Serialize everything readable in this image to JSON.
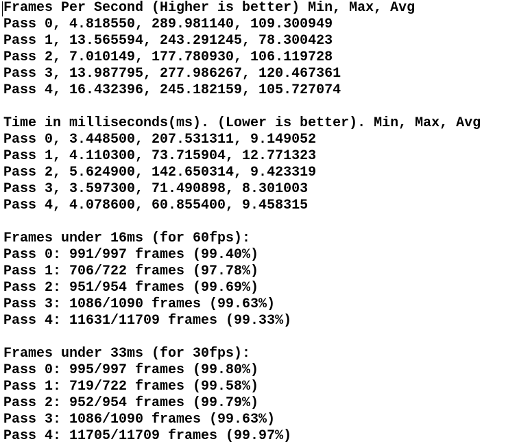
{
  "sections": [
    {
      "header": "Frames Per Second (Higher is better) Min, Max, Avg",
      "lines": [
        "Pass 0, 4.818550, 289.981140, 109.300949",
        "Pass 1, 13.565594, 243.291245, 78.300423",
        "Pass 2, 7.010149, 177.780930, 106.119728",
        "Pass 3, 13.987795, 277.986267, 120.467361",
        "Pass 4, 16.432396, 245.182159, 105.727074"
      ]
    },
    {
      "header": "Time in milliseconds(ms). (Lower is better). Min, Max, Avg",
      "lines": [
        "Pass 0, 3.448500, 207.531311, 9.149052",
        "Pass 1, 4.110300, 73.715904, 12.771323",
        "Pass 2, 5.624900, 142.650314, 9.423319",
        "Pass 3, 3.597300, 71.490898, 8.301003",
        "Pass 4, 4.078600, 60.855400, 9.458315"
      ]
    },
    {
      "header": "Frames under 16ms (for 60fps):",
      "lines": [
        "Pass 0: 991/997 frames (99.40%)",
        "Pass 1: 706/722 frames (97.78%)",
        "Pass 2: 951/954 frames (99.69%)",
        "Pass 3: 1086/1090 frames (99.63%)",
        "Pass 4: 11631/11709 frames (99.33%)"
      ]
    },
    {
      "header": "Frames under 33ms (for 30fps):",
      "lines": [
        "Pass 0: 995/997 frames (99.80%)",
        "Pass 1: 719/722 frames (99.58%)",
        "Pass 2: 952/954 frames (99.79%)",
        "Pass 3: 1086/1090 frames (99.63%)",
        "Pass 4: 11705/11709 frames (99.97%)"
      ]
    }
  ]
}
